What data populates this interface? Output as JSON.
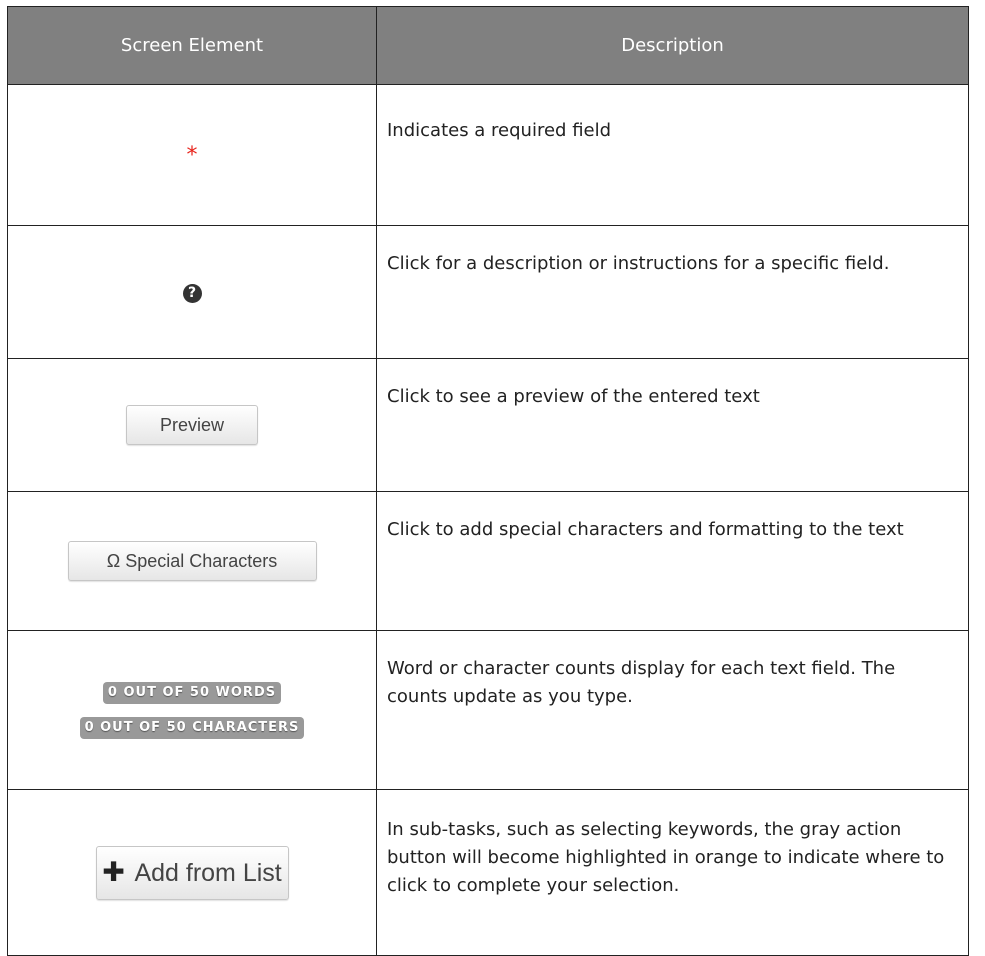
{
  "table": {
    "headers": [
      "Screen Element",
      "Description"
    ],
    "rows": [
      {
        "element_glyph": "*",
        "element_icon": "required-asterisk-icon",
        "description": "Indicates a required field"
      },
      {
        "element_glyph": "?",
        "element_icon": "question-circle-icon",
        "description": "Click for a description or instructions for a specific field."
      },
      {
        "element_label": "Preview",
        "description": "Click to see a preview of the entered text"
      },
      {
        "element_symbol": "Ω",
        "element_label": "Special Characters",
        "description": "Click to add special characters and formatting to the text"
      },
      {
        "element_counters": [
          "0 OUT OF 50 WORDS",
          "0 OUT OF 50 CHARACTERS"
        ],
        "description": "Word or character counts display for each text field. The counts update as you type."
      },
      {
        "element_symbol": "✚",
        "element_label": "Add from List",
        "description": "In sub-tasks, such as selecting keywords, the gray action button will become highlighted in orange to indicate where to click to complete your selection."
      }
    ]
  },
  "colors": {
    "header_bg": "#808080",
    "required_star": "#e8241c",
    "counter_badge": "#999999"
  }
}
